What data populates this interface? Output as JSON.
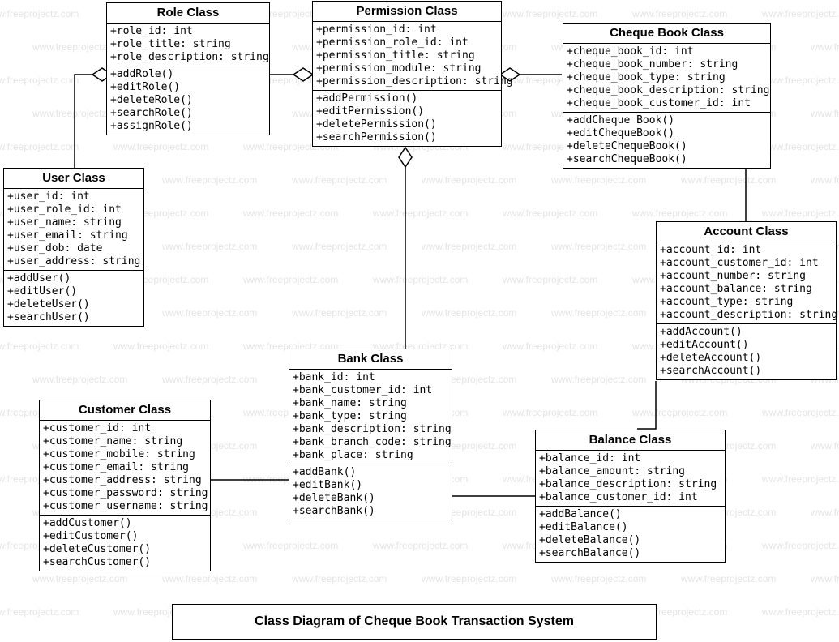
{
  "diagram_title": "Class Diagram of Cheque Book Transaction System",
  "watermark_text": "www.freeprojectz.com",
  "classes": {
    "role": {
      "name": "Role Class",
      "attributes": [
        "+role_id: int",
        "+role_title: string",
        "+role_description: string"
      ],
      "operations": [
        "+addRole()",
        "+editRole()",
        "+deleteRole()",
        "+searchRole()",
        "+assignRole()"
      ]
    },
    "permission": {
      "name": "Permission Class",
      "attributes": [
        "+permission_id: int",
        "+permission_role_id: int",
        "+permission_title: string",
        "+permission_module: string",
        "+permission_description: string"
      ],
      "operations": [
        "+addPermission()",
        "+editPermission()",
        "+deletePermission()",
        "+searchPermission()"
      ]
    },
    "chequebook": {
      "name": "Cheque Book Class",
      "attributes": [
        "+cheque_book_id: int",
        "+cheque_book_number: string",
        "+cheque_book_type: string",
        "+cheque_book_description: string",
        "+cheque_book_customer_id: int"
      ],
      "operations": [
        "+addCheque Book()",
        "+editChequeBook()",
        "+deleteChequeBook()",
        "+searchChequeBook()"
      ]
    },
    "user": {
      "name": "User Class",
      "attributes": [
        "+user_id: int",
        "+user_role_id: int",
        "+user_name: string",
        "+user_email: string",
        "+user_dob: date",
        "+user_address: string"
      ],
      "operations": [
        "+addUser()",
        "+editUser()",
        "+deleteUser()",
        "+searchUser()"
      ]
    },
    "account": {
      "name": "Account Class",
      "attributes": [
        "+account_id: int",
        "+account_customer_id: int",
        "+account_number: string",
        "+account_balance: string",
        "+account_type: string",
        "+account_description: string"
      ],
      "operations": [
        "+addAccount()",
        "+editAccount()",
        "+deleteAccount()",
        "+searchAccount()"
      ]
    },
    "bank": {
      "name": "Bank Class",
      "attributes": [
        "+bank_id: int",
        "+bank_customer_id: int",
        "+bank_name: string",
        "+bank_type: string",
        "+bank_description: string",
        "+bank_branch_code: string",
        "+bank_place: string"
      ],
      "operations": [
        "+addBank()",
        "+editBank()",
        "+deleteBank()",
        "+searchBank()"
      ]
    },
    "customer": {
      "name": "Customer Class",
      "attributes": [
        "+customer_id: int",
        "+customer_name: string",
        "+customer_mobile: string",
        "+customer_email: string",
        "+customer_address: string",
        "+customer_password: string",
        "+customer_username: string"
      ],
      "operations": [
        "+addCustomer()",
        "+editCustomer()",
        "+deleteCustomer()",
        "+searchCustomer()"
      ]
    },
    "balance": {
      "name": "Balance Class",
      "attributes": [
        "+balance_id: int",
        "+balance_amount: string",
        "+balance_description: string",
        "+balance_customer_id: int"
      ],
      "operations": [
        "+addBalance()",
        "+editBalance()",
        "+deleteBalance()",
        "+searchBalance()"
      ]
    }
  },
  "relationships": [
    {
      "from": "User",
      "to": "Role",
      "type": "aggregation"
    },
    {
      "from": "Role",
      "to": "Permission",
      "type": "aggregation"
    },
    {
      "from": "Permission",
      "to": "ChequeBook",
      "type": "aggregation"
    },
    {
      "from": "Permission",
      "to": "Bank",
      "type": "aggregation"
    },
    {
      "from": "Bank",
      "to": "Customer",
      "type": "association"
    },
    {
      "from": "ChequeBook",
      "to": "Account",
      "type": "association"
    },
    {
      "from": "Account",
      "to": "Balance",
      "type": "association"
    },
    {
      "from": "Balance",
      "to": "Bank",
      "type": "association"
    }
  ]
}
